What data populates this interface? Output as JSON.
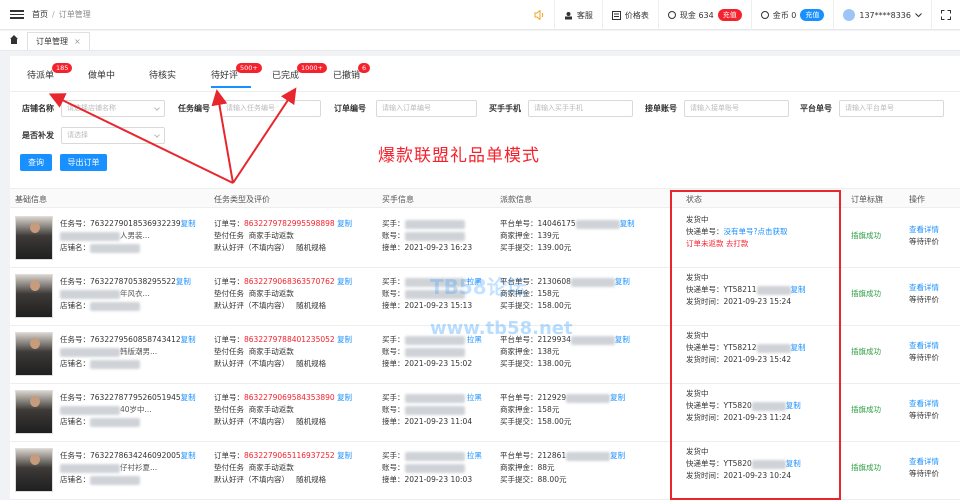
{
  "topbar": {
    "breadcrumb_home": "首页",
    "breadcrumb_sep": "/",
    "breadcrumb_current": "订单管理",
    "service": "客服",
    "price": "价格表",
    "cash": "现金 634",
    "cash_btn": "充值",
    "gold": "金币 0",
    "gold_btn": "充值",
    "user": "137****8336"
  },
  "tabs": {
    "open_tab": "订单管理",
    "close": "×"
  },
  "status_tabs": [
    {
      "label": "待派单",
      "count": "185"
    },
    {
      "label": "做单中",
      "count": ""
    },
    {
      "label": "待核实",
      "count": ""
    },
    {
      "label": "待好评",
      "count": "500+"
    },
    {
      "label": "已完成",
      "count": "1000+"
    },
    {
      "label": "已撤销",
      "count": "6"
    }
  ],
  "filters": {
    "shop_label": "店铺名称",
    "shop_ph": "请选择店铺名称",
    "task_label": "任务编号",
    "task_ph": "请输入任务编号",
    "order_label": "订单编号",
    "order_ph": "请输入订单编号",
    "buyer_label": "买手手机",
    "buyer_ph": "请输入买手手机",
    "account_label": "接单账号",
    "account_ph": "请输入接单账号",
    "platform_label": "平台单号",
    "platform_ph": "请输入平台单号",
    "supp_label": "是否补发",
    "supp_ph": "请选择",
    "query": "查询",
    "export": "导出订单"
  },
  "banner": "爆款联盟礼品单模式",
  "watermark": {
    "line1": "TB58论坛",
    "line2": "www.tb58.net"
  },
  "table": {
    "headers": [
      "基础信息",
      "任务类型及评价",
      "买手信息",
      "派款信息",
      "状态",
      "订单标旗",
      "操作"
    ],
    "rows": [
      {
        "task_label": "任务号：",
        "task_no": "7632279018536932239",
        "task_copy": "复制",
        "title_tail": "人男装...",
        "shop_label": "店铺名：",
        "order_label": "订单号：",
        "order_no": "8632279782995598898",
        "order_copy": "复制",
        "type1": "垫付任务",
        "type2": "商家手动返款",
        "eval": "默认好评（不填内容）",
        "spec": "随机规格",
        "buyer_label": "买手：",
        "buyer_tail": "",
        "acct_label": "账号：",
        "take_label": "接单：",
        "take_time": "2021-09-23 16:23",
        "plat_label": "平台单号：",
        "plat_no": "14046175",
        "plat_copy": "复制",
        "deposit_label": "商家押金：",
        "deposit": "139元",
        "submit_label": "买手提交：",
        "submit": "139.00元",
        "status": "发货中",
        "express_label": "快递单号：",
        "express": "没有单号?点击获取",
        "express_extra": "订单未返款 去打款",
        "flag": "插旗成功",
        "op1": "查看详情",
        "op2": "等待评价"
      },
      {
        "task_label": "任务号：",
        "task_no": "763227870538295522",
        "task_copy": "复制",
        "title_tail": "年风衣...",
        "shop_label": "店铺名：",
        "order_label": "订单号：",
        "order_no": "8632279068363570762",
        "order_copy": "复制",
        "type1": "垫付任务",
        "type2": "商家手动返款",
        "eval": "默认好评（不填内容）",
        "spec": "随机规格",
        "buyer_label": "买手：",
        "buyer_tail": "拉黑",
        "acct_label": "账号：",
        "take_label": "接单：",
        "take_time": "2021-09-23 15:13",
        "plat_label": "平台单号：",
        "plat_no": "2130608",
        "plat_copy": "复制",
        "deposit_label": "商家押金：",
        "deposit": "158元",
        "submit_label": "买手提交：",
        "submit": "158.00元",
        "status": "发货中",
        "express_label": "快递单号：",
        "express": "YT58211",
        "express_copy": "复制",
        "ship_label": "发货时间：",
        "ship_time": "2021-09-23 15:24",
        "flag": "插旗成功",
        "op1": "查看详情",
        "op2": "等待评价"
      },
      {
        "task_label": "任务号：",
        "task_no": "7632279560858743412",
        "task_copy": "复制",
        "title_tail": "韩版潮男...",
        "shop_label": "店铺名：",
        "order_label": "订单号：",
        "order_no": "8632279788401235052",
        "order_copy": "复制",
        "type1": "垫付任务",
        "type2": "商家手动返款",
        "eval": "默认好评（不填内容）",
        "spec": "随机规格",
        "buyer_label": "买手：",
        "buyer_tail": "拉黑",
        "acct_label": "账号：",
        "take_label": "接单：",
        "take_time": "2021-09-23 15:02",
        "plat_label": "平台单号：",
        "plat_no": "2129934",
        "plat_copy": "复制",
        "deposit_label": "商家押金：",
        "deposit": "138元",
        "submit_label": "买手提交：",
        "submit": "138.00元",
        "status": "发货中",
        "express_label": "快递单号：",
        "express": "YT58212",
        "express_copy": "复制",
        "ship_label": "发货时间：",
        "ship_time": "2021-09-23 15:42",
        "flag": "插旗成功",
        "op1": "查看详情",
        "op2": "等待评价"
      },
      {
        "task_label": "任务号：",
        "task_no": "7632278779526051945",
        "task_copy": "复制",
        "title_tail": "40岁中...",
        "shop_label": "店铺名：",
        "order_label": "订单号：",
        "order_no": "8632279069584353890",
        "order_copy": "复制",
        "type1": "垫付任务",
        "type2": "商家手动返款",
        "eval": "默认好评（不填内容）",
        "spec": "随机规格",
        "buyer_label": "买手：",
        "buyer_tail": "拉黑",
        "acct_label": "账号：",
        "take_label": "接单：",
        "take_time": "2021-09-23 11:04",
        "plat_label": "平台单号：",
        "plat_no": "212929",
        "plat_copy": "复制",
        "deposit_label": "商家押金：",
        "deposit": "158元",
        "submit_label": "买手提交：",
        "submit": "158.00元",
        "status": "发货中",
        "express_label": "快递单号：",
        "express": "YT5820",
        "express_copy": "复制",
        "ship_label": "发货时间：",
        "ship_time": "2021-09-23 11:24",
        "flag": "插旗成功",
        "op1": "查看详情",
        "op2": "等待评价"
      },
      {
        "task_label": "任务号：",
        "task_no": "7632278634246092005",
        "task_copy": "复制",
        "title_tail": "仔衬衫夏...",
        "shop_label": "店铺名：",
        "order_label": "订单号：",
        "order_no": "8632279065116937252",
        "order_copy": "复制",
        "type1": "垫付任务",
        "type2": "商家手动返款",
        "eval": "默认好评（不填内容）",
        "spec": "随机规格",
        "buyer_label": "买手：",
        "buyer_tail": "拉黑",
        "acct_label": "账号：",
        "take_label": "接单：",
        "take_time": "2021-09-23 10:03",
        "plat_label": "平台单号：",
        "plat_no": "212861",
        "plat_copy": "复制",
        "deposit_label": "商家押金：",
        "deposit": "88元",
        "submit_label": "买手提交：",
        "submit": "88.00元",
        "status": "发货中",
        "express_label": "快递单号：",
        "express": "YT5820",
        "express_copy": "复制",
        "ship_label": "发货时间：",
        "ship_time": "2021-09-23 10:24",
        "flag": "插旗成功",
        "op1": "查看详情",
        "op2": "等待评价"
      }
    ]
  }
}
